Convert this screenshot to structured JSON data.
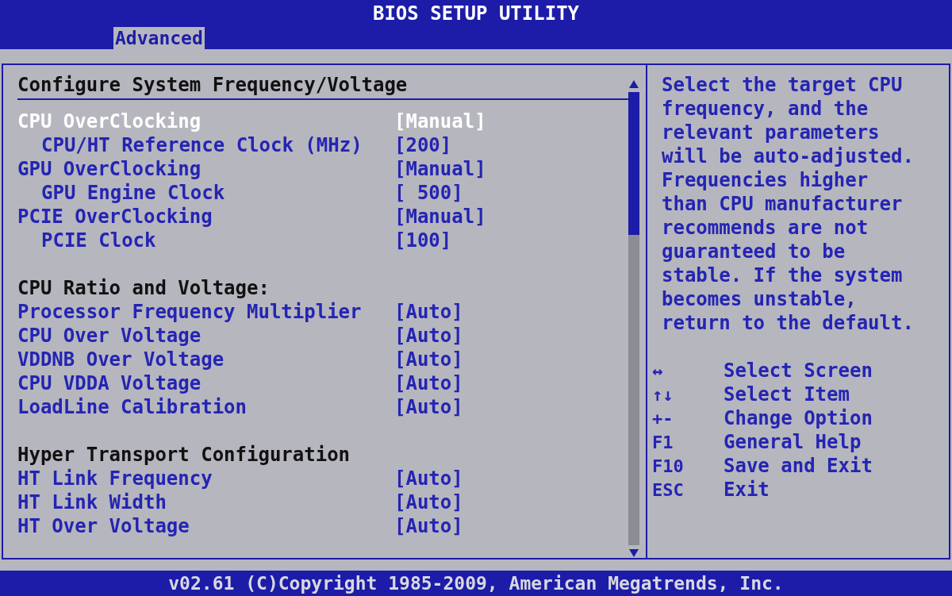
{
  "window": {
    "title": "BIOS SETUP UTILITY"
  },
  "tabs": [
    {
      "label": "Advanced",
      "selected": true
    }
  ],
  "panel": {
    "heading": "Configure System Frequency/Voltage",
    "items": [
      {
        "kind": "setting",
        "label": "CPU OverClocking",
        "value": "[Manual]",
        "selected": true,
        "children": [
          {
            "kind": "setting",
            "label": "CPU/HT Reference Clock (MHz)",
            "value": "[200]",
            "selected": false
          }
        ]
      },
      {
        "kind": "setting",
        "label": "GPU OverClocking",
        "value": "[Manual]",
        "selected": false,
        "children": [
          {
            "kind": "setting",
            "label": "GPU Engine Clock",
            "value": "[ 500]",
            "selected": false
          }
        ]
      },
      {
        "kind": "setting",
        "label": "PCIE OverClocking",
        "value": "[Manual]",
        "selected": false,
        "children": [
          {
            "kind": "setting",
            "label": "PCIE Clock",
            "value": "[100]",
            "selected": false
          }
        ]
      },
      {
        "kind": "heading",
        "label": "CPU Ratio and Voltage:"
      },
      {
        "kind": "setting",
        "label": "Processor Frequency Multiplier",
        "value": "[Auto]",
        "selected": false
      },
      {
        "kind": "setting",
        "label": "CPU Over Voltage",
        "value": "[Auto]",
        "selected": false
      },
      {
        "kind": "setting",
        "label": "VDDNB Over Voltage",
        "value": "[Auto]",
        "selected": false
      },
      {
        "kind": "setting",
        "label": "CPU VDDA Voltage",
        "value": "[Auto]",
        "selected": false
      },
      {
        "kind": "setting",
        "label": "LoadLine Calibration",
        "value": "[Auto]",
        "selected": false
      },
      {
        "kind": "heading",
        "label": "Hyper Transport Configuration"
      },
      {
        "kind": "setting",
        "label": "HT Link Frequency",
        "value": "[Auto]",
        "selected": false
      },
      {
        "kind": "setting",
        "label": "HT Link Width",
        "value": "[Auto]",
        "selected": false
      },
      {
        "kind": "setting",
        "label": "HT Over Voltage",
        "value": "[Auto]",
        "selected": false
      }
    ]
  },
  "help": {
    "text": "Select the target CPU frequency, and the relevant parameters will be auto-adjusted. Frequencies higher than CPU manufacturer recommends are not guaranteed to be stable. If the system becomes unstable, return to the default.",
    "keys": [
      {
        "key": "↔",
        "action": "Select Screen"
      },
      {
        "key": "↑↓",
        "action": "Select Item"
      },
      {
        "key": "+-",
        "action": "Change Option"
      },
      {
        "key": "F1",
        "action": "General Help"
      },
      {
        "key": "F10",
        "action": "Save and Exit"
      },
      {
        "key": "ESC",
        "action": "Exit"
      }
    ]
  },
  "status_bar": "v02.61 (C)Copyright 1985-2009, American Megatrends, Inc."
}
